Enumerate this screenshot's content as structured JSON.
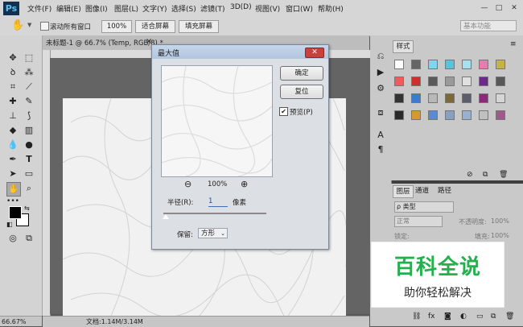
{
  "app": {
    "logo": "Ps"
  },
  "menu": [
    "文件(F)",
    "编辑(E)",
    "图像(I)",
    "图层(L)",
    "文字(Y)",
    "选择(S)",
    "滤镜(T)",
    "3D(D)",
    "视图(V)",
    "窗口(W)",
    "帮助(H)"
  ],
  "window_controls": {
    "minimize": "—",
    "maximize": "□",
    "close": "✕"
  },
  "options_bar": {
    "scroll_all_windows": "滚动所有窗口",
    "zoom_100": "100%",
    "fit_screen": "适合屏幕",
    "fill_screen": "填充屏幕",
    "workspace": "基本功能"
  },
  "document": {
    "tab_title": "未标题-1 @ 66.7% (Temp, RGB/8) *",
    "close_glyph": "×"
  },
  "status": {
    "zoom": "66.67%",
    "doc_info": "文档:1.14M/3.14M"
  },
  "dialog": {
    "title": "最大值",
    "ok": "确定",
    "reset": "复位",
    "preview_label": "预览(P)",
    "preview_checked": "✔",
    "preview_zoom": "100%",
    "zoom_out": "⊖",
    "zoom_in": "⊕",
    "radius_label": "半径(R):",
    "radius_value": "1",
    "radius_unit": "像素",
    "slider_value": 1,
    "keep_label": "保留:",
    "keep_value": "方形",
    "close_glyph": "✕"
  },
  "styles_panel": {
    "tab": "样式"
  },
  "layers_panel": {
    "tabs": [
      "图层",
      "通道",
      "路径"
    ],
    "kind_label": "ρ 类型",
    "blend_mode": "正常",
    "opacity_label": "不透明度:",
    "opacity_value": "100%",
    "lock_label": "锁定:",
    "fill_label": "填充:",
    "fill_value": "100%"
  },
  "watermark": {
    "main": "百科全说",
    "sub": "助你轻松解决"
  },
  "colors": {
    "accent_green": "#22b14c",
    "dialog_close": "#c8423b",
    "ps_blue": "#13314f"
  }
}
